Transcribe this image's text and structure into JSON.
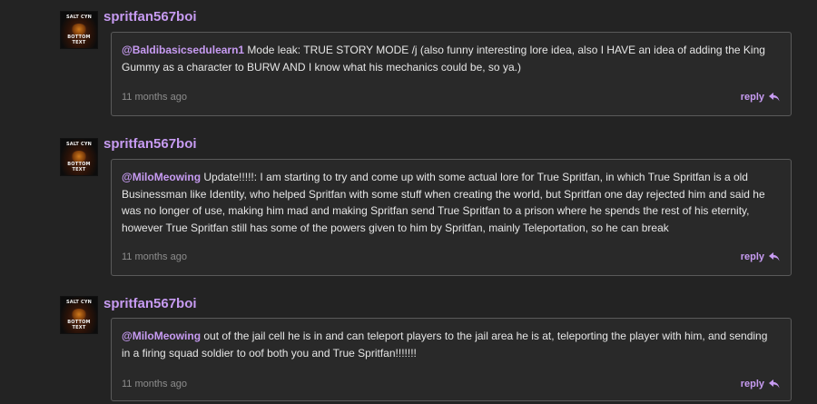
{
  "avatar": {
    "top_text": "SALT CYN",
    "bottom_text": "BOTTOM TEXT"
  },
  "comments": [
    {
      "username": "spritfan567boi",
      "mention": "@Baldibasicsedulearn1",
      "text": " Mode leak: TRUE STORY MODE /j (also funny interesting lore idea, also I HAVE an idea of adding the King Gummy as a character to BURW AND I know what his mechanics could be, so ya.)",
      "timestamp": "11 months ago",
      "reply_label": "reply"
    },
    {
      "username": "spritfan567boi",
      "mention": "@MiloMeowing",
      "text": " Update!!!!!: I am starting to try and come up with some actual lore for True Spritfan, in which True Spritfan is a old Businessman like Identity, who helped Spritfan with some stuff when creating the world, but Spritfan one day rejected him and said he was no longer of use, making him mad and making Spritfan send True Spritfan to a prison where he spends the rest of his eternity, however True Spritfan still has some of the powers given to him by Spritfan, mainly Teleportation, so he can break",
      "timestamp": "11 months ago",
      "reply_label": "reply"
    },
    {
      "username": "spritfan567boi",
      "mention": "@MiloMeowing",
      "text": " out of the jail cell he is in and can teleport players to the jail area he is at, teleporting the player with him, and sending in a firing squad soldier to oof both you and True Spritfan!!!!!!!",
      "timestamp": "11 months ago",
      "reply_label": "reply"
    }
  ]
}
